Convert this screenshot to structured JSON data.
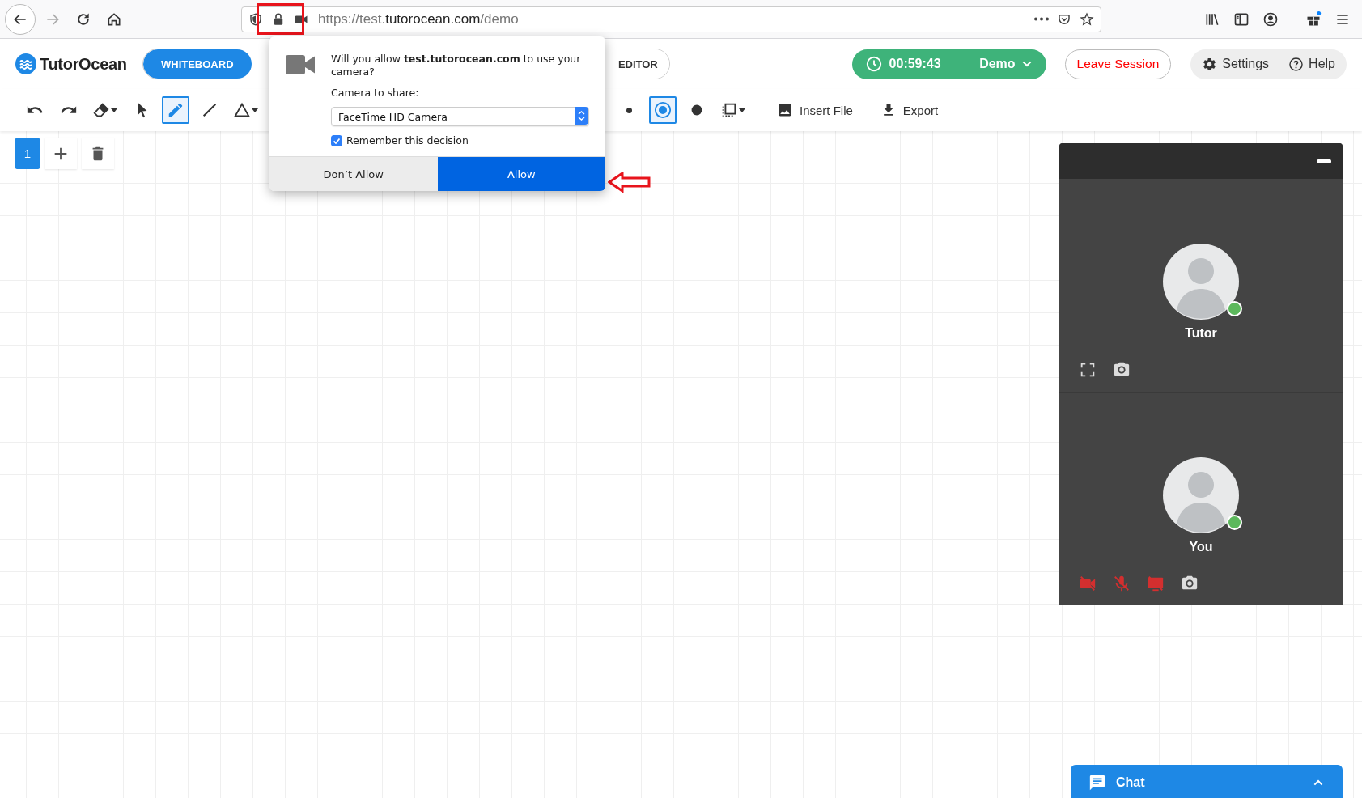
{
  "browser": {
    "url": {
      "prefix": "https://test.",
      "domain": "tutorocean.com",
      "path": "/demo"
    }
  },
  "app": {
    "logo": "TutorOcean",
    "modes": [
      {
        "label": "WHITEBOARD",
        "selected": true
      },
      {
        "label": "EDITOR",
        "selected": false
      }
    ],
    "timer": "00:59:43",
    "session_menu": "Demo",
    "leave": "Leave Session",
    "settings": "Settings",
    "help": "Help"
  },
  "toolbar": {
    "tools_left": [
      {
        "kind": "undo",
        "selected": false,
        "caret": false
      },
      {
        "kind": "redo",
        "selected": false,
        "caret": false
      },
      {
        "kind": "eraser",
        "selected": false,
        "caret": true
      },
      {
        "kind": "pointer",
        "selected": false,
        "caret": false
      },
      {
        "kind": "pencil",
        "selected": true,
        "caret": false
      },
      {
        "kind": "line",
        "selected": false,
        "caret": false
      },
      {
        "kind": "triangle",
        "selected": false,
        "caret": true
      }
    ],
    "tools_right": [
      {
        "kind": "dot-small",
        "selected": false,
        "caret": false
      },
      {
        "kind": "dot-medium",
        "selected": true,
        "caret": false
      },
      {
        "kind": "dot-large",
        "selected": false,
        "caret": false
      },
      {
        "kind": "selection",
        "selected": false,
        "caret": true
      }
    ],
    "actions": [
      {
        "kind": "image",
        "label": "Insert File"
      },
      {
        "kind": "download",
        "label": "Export"
      }
    ]
  },
  "pages": {
    "current": "1"
  },
  "permission_prompt": {
    "question": "Will you allow **test.tutorocean.com** to use your camera?",
    "select_label": "Camera to share:",
    "camera": "FaceTime HD Camera",
    "remember": {
      "label": "Remember this decision",
      "checked": true
    },
    "deny": "Don’t Allow",
    "allow": "Allow"
  },
  "video": {
    "tiles": [
      {
        "name": "Tutor",
        "online": true,
        "controls": [
          {
            "kind": "fullscreen",
            "off": false
          },
          {
            "kind": "snapshot",
            "off": false
          }
        ]
      },
      {
        "name": "You",
        "online": true,
        "controls": [
          {
            "kind": "camera",
            "off": true
          },
          {
            "kind": "mic",
            "off": true
          },
          {
            "kind": "screen",
            "off": true
          },
          {
            "kind": "snapshot",
            "off": false
          }
        ]
      }
    ]
  },
  "chat": {
    "label": "Chat",
    "expanded": false
  }
}
